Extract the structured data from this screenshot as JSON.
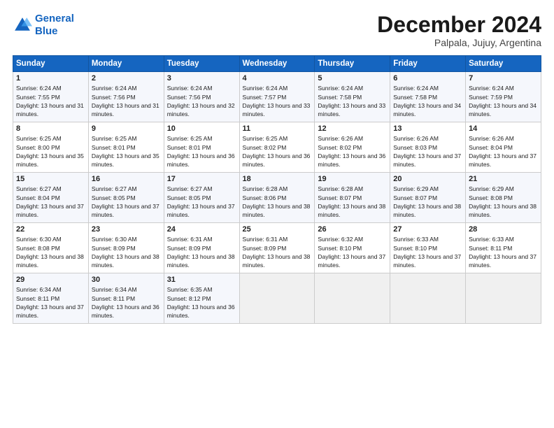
{
  "logo": {
    "line1": "General",
    "line2": "Blue"
  },
  "title": "December 2024",
  "subtitle": "Palpala, Jujuy, Argentina",
  "days_of_week": [
    "Sunday",
    "Monday",
    "Tuesday",
    "Wednesday",
    "Thursday",
    "Friday",
    "Saturday"
  ],
  "weeks": [
    [
      {
        "day": 1,
        "sunrise": "6:24 AM",
        "sunset": "7:55 PM",
        "daylight": "13 hours and 31 minutes."
      },
      {
        "day": 2,
        "sunrise": "6:24 AM",
        "sunset": "7:56 PM",
        "daylight": "13 hours and 31 minutes."
      },
      {
        "day": 3,
        "sunrise": "6:24 AM",
        "sunset": "7:56 PM",
        "daylight": "13 hours and 32 minutes."
      },
      {
        "day": 4,
        "sunrise": "6:24 AM",
        "sunset": "7:57 PM",
        "daylight": "13 hours and 33 minutes."
      },
      {
        "day": 5,
        "sunrise": "6:24 AM",
        "sunset": "7:58 PM",
        "daylight": "13 hours and 33 minutes."
      },
      {
        "day": 6,
        "sunrise": "6:24 AM",
        "sunset": "7:58 PM",
        "daylight": "13 hours and 34 minutes."
      },
      {
        "day": 7,
        "sunrise": "6:24 AM",
        "sunset": "7:59 PM",
        "daylight": "13 hours and 34 minutes."
      }
    ],
    [
      {
        "day": 8,
        "sunrise": "6:25 AM",
        "sunset": "8:00 PM",
        "daylight": "13 hours and 35 minutes."
      },
      {
        "day": 9,
        "sunrise": "6:25 AM",
        "sunset": "8:01 PM",
        "daylight": "13 hours and 35 minutes."
      },
      {
        "day": 10,
        "sunrise": "6:25 AM",
        "sunset": "8:01 PM",
        "daylight": "13 hours and 36 minutes."
      },
      {
        "day": 11,
        "sunrise": "6:25 AM",
        "sunset": "8:02 PM",
        "daylight": "13 hours and 36 minutes."
      },
      {
        "day": 12,
        "sunrise": "6:26 AM",
        "sunset": "8:02 PM",
        "daylight": "13 hours and 36 minutes."
      },
      {
        "day": 13,
        "sunrise": "6:26 AM",
        "sunset": "8:03 PM",
        "daylight": "13 hours and 37 minutes."
      },
      {
        "day": 14,
        "sunrise": "6:26 AM",
        "sunset": "8:04 PM",
        "daylight": "13 hours and 37 minutes."
      }
    ],
    [
      {
        "day": 15,
        "sunrise": "6:27 AM",
        "sunset": "8:04 PM",
        "daylight": "13 hours and 37 minutes."
      },
      {
        "day": 16,
        "sunrise": "6:27 AM",
        "sunset": "8:05 PM",
        "daylight": "13 hours and 37 minutes."
      },
      {
        "day": 17,
        "sunrise": "6:27 AM",
        "sunset": "8:05 PM",
        "daylight": "13 hours and 37 minutes."
      },
      {
        "day": 18,
        "sunrise": "6:28 AM",
        "sunset": "8:06 PM",
        "daylight": "13 hours and 38 minutes."
      },
      {
        "day": 19,
        "sunrise": "6:28 AM",
        "sunset": "8:07 PM",
        "daylight": "13 hours and 38 minutes."
      },
      {
        "day": 20,
        "sunrise": "6:29 AM",
        "sunset": "8:07 PM",
        "daylight": "13 hours and 38 minutes."
      },
      {
        "day": 21,
        "sunrise": "6:29 AM",
        "sunset": "8:08 PM",
        "daylight": "13 hours and 38 minutes."
      }
    ],
    [
      {
        "day": 22,
        "sunrise": "6:30 AM",
        "sunset": "8:08 PM",
        "daylight": "13 hours and 38 minutes."
      },
      {
        "day": 23,
        "sunrise": "6:30 AM",
        "sunset": "8:09 PM",
        "daylight": "13 hours and 38 minutes."
      },
      {
        "day": 24,
        "sunrise": "6:31 AM",
        "sunset": "8:09 PM",
        "daylight": "13 hours and 38 minutes."
      },
      {
        "day": 25,
        "sunrise": "6:31 AM",
        "sunset": "8:09 PM",
        "daylight": "13 hours and 38 minutes."
      },
      {
        "day": 26,
        "sunrise": "6:32 AM",
        "sunset": "8:10 PM",
        "daylight": "13 hours and 37 minutes."
      },
      {
        "day": 27,
        "sunrise": "6:33 AM",
        "sunset": "8:10 PM",
        "daylight": "13 hours and 37 minutes."
      },
      {
        "day": 28,
        "sunrise": "6:33 AM",
        "sunset": "8:11 PM",
        "daylight": "13 hours and 37 minutes."
      }
    ],
    [
      {
        "day": 29,
        "sunrise": "6:34 AM",
        "sunset": "8:11 PM",
        "daylight": "13 hours and 37 minutes."
      },
      {
        "day": 30,
        "sunrise": "6:34 AM",
        "sunset": "8:11 PM",
        "daylight": "13 hours and 36 minutes."
      },
      {
        "day": 31,
        "sunrise": "6:35 AM",
        "sunset": "8:12 PM",
        "daylight": "13 hours and 36 minutes."
      },
      null,
      null,
      null,
      null
    ]
  ]
}
